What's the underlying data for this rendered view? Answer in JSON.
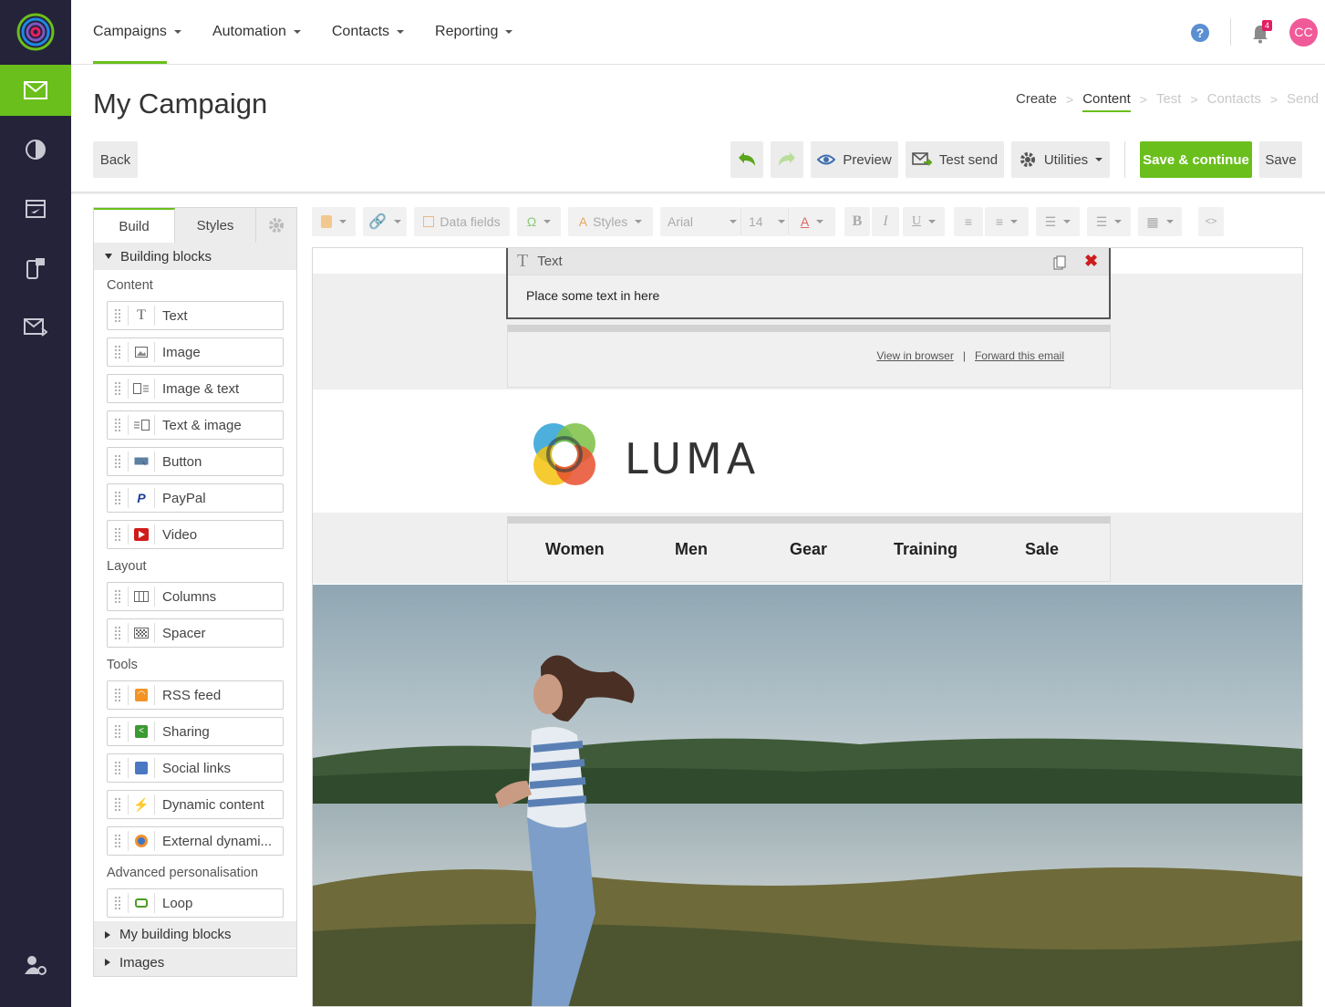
{
  "topnav": {
    "items": [
      {
        "label": "Campaigns"
      },
      {
        "label": "Automation"
      },
      {
        "label": "Contacts"
      },
      {
        "label": "Reporting"
      }
    ],
    "notifications_count": "4",
    "avatar_initials": "CC"
  },
  "page": {
    "title": "My Campaign"
  },
  "steps": [
    {
      "label": "Create",
      "state": "done"
    },
    {
      "label": "Content",
      "state": "current"
    },
    {
      "label": "Test",
      "state": "disabled"
    },
    {
      "label": "Contacts",
      "state": "disabled"
    },
    {
      "label": "Send",
      "state": "disabled"
    }
  ],
  "toolbar": {
    "back": "Back",
    "preview": "Preview",
    "test_send": "Test send",
    "utilities": "Utilities",
    "save_continue": "Save & continue",
    "save": "Save"
  },
  "panel": {
    "tabs": {
      "build": "Build",
      "styles": "Styles"
    },
    "section_building_blocks": "Building blocks",
    "groups": {
      "content": "Content",
      "layout": "Layout",
      "tools": "Tools",
      "advanced": "Advanced personalisation"
    },
    "content_blocks": [
      "Text",
      "Image",
      "Image & text",
      "Text & image",
      "Button",
      "PayPal",
      "Video"
    ],
    "layout_blocks": [
      "Columns",
      "Spacer"
    ],
    "tools_blocks": [
      "RSS feed",
      "Sharing",
      "Social links",
      "Dynamic content",
      "External dynami..."
    ],
    "advanced_blocks": [
      "Loop"
    ],
    "section_my_blocks": "My building blocks",
    "section_images": "Images"
  },
  "editor_toolbar": {
    "data_fields": "Data fields",
    "styles": "Styles",
    "font": "Arial",
    "size": "14"
  },
  "canvas": {
    "selected_block_title": "Text",
    "selected_block_text": "Place some text in here",
    "view_in_browser": "View in browser",
    "pipe": "|",
    "forward_email": "Forward this email",
    "brand": "LUMA",
    "nav": [
      "Women",
      "Men",
      "Gear",
      "Training",
      "Sale"
    ]
  },
  "colors": {
    "accent_green": "#6abf1c",
    "sidebar_dark": "#25233a",
    "badge_pink": "#e31d63",
    "avatar_pink": "#f05a98"
  }
}
